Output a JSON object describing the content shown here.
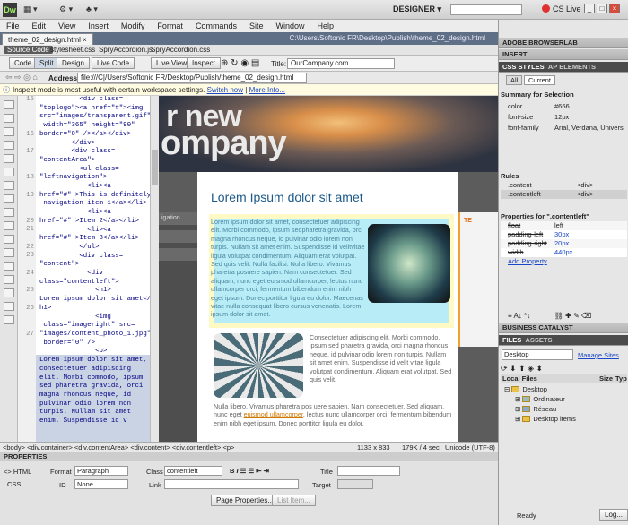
{
  "app": {
    "logo": "Dw",
    "workspace": "DESIGNER ▾",
    "cs_live": "CS Live",
    "window_controls": [
      "_",
      "□",
      "×"
    ]
  },
  "menu": [
    "File",
    "Edit",
    "View",
    "Insert",
    "Modify",
    "Format",
    "Commands",
    "Site",
    "Window",
    "Help"
  ],
  "document": {
    "tab": "theme_02_design.html ×",
    "path": "C:\\Users\\Softonic FR\\Desktop\\Publish\\theme_02_design.html",
    "related_files": [
      "Source Code",
      "stylesheet.css",
      "SpryAccordion.js",
      "SpryAccordion.css"
    ]
  },
  "toolbar": {
    "code": "Code",
    "split": "Split",
    "design": "Design",
    "live_code": "Live Code",
    "live_view": "Live View",
    "inspect": "Inspect",
    "title_label": "Title:",
    "title_value": "OurCompany.com"
  },
  "address": {
    "label": "Address:",
    "value": "file:///C|/Users/Softonic FR/Desktop/Publish/theme_02_design.html"
  },
  "infobar": {
    "text": "Inspect mode is most useful with certain workspace settings.",
    "switch": "Switch now",
    "more": "More Info..."
  },
  "code": {
    "line_numbers": [
      "15",
      "",
      "",
      "",
      "16",
      "",
      "17",
      "",
      "",
      "18",
      "",
      "19",
      "",
      "",
      "20",
      "21",
      "",
      "22",
      "23",
      "",
      "24",
      "",
      "25",
      "",
      "26",
      "",
      "",
      "27",
      "",
      "",
      "",
      "",
      "",
      "",
      "",
      ""
    ],
    "lines": [
      "          <div class=",
      "\"toplogo\"><a href=\"#\"><img",
      "src=\"images/transparent.gif\"",
      " width=\"365\" height=\"90\"",
      "border=\"0\" /></a></div>",
      "        </div>",
      "        <div class=",
      "\"contentArea\">",
      "          <ul class=",
      "\"leftnavigation\">",
      "            <li><a",
      "href=\"#\" >This is definitely",
      " navigation item 1</a></li>",
      "            <li><a",
      "href=\"#\" >Item 2</a></li>",
      "            <li><a",
      "href=\"#\" >Item 3</a></li>",
      "          </ul>",
      "          <div class=",
      "\"content\">",
      "            <div",
      "class=\"contentleft\">",
      "              <h1>",
      "Lorem ipsum dolor sit amet</",
      "h1>",
      "              <img",
      " class=\"imageright\" src=",
      "\"images/content_photo_1.jpg\"",
      " border=\"0\" />",
      "              <p>",
      "Lorem ipsum dolor sit amet,",
      "consectetuer adipiscing",
      "elit. Morbi commodo, ipsum",
      "sed pharetra gravida, orci",
      "magna rhoncus neque, id",
      "pulvinar odio lorem non",
      "turpis. Nullam sit amet",
      "enim. Suspendisse id v"
    ]
  },
  "design": {
    "logo_text_1": "r new",
    "logo_text_2": "ompany",
    "nav_items": [
      "igation",
      "",
      ""
    ],
    "heading": "Lorem Ipsum dolor sit amet",
    "para1": "Lorem ipsum dolor sit amet, consectetuer adipiscing elit. Morbi commodo, ipsum sedpharetra gravida, orci magna rhoncus neque, id pulvinar odio lorem non turpis. Nullam sit amet enim. Suspendisse id velitvitae ligula volutpat condimentum. Aliquam erat volutpat. Sed quis velit. Nulla facilisi. Nulla libero. Vivamus pharetra posuere sapien. Nam consectetuer. Sed aliquam, nunc eget euismod ullamcorper, lectus nunc ullamcorper orci, fermentum bibendum enim nibh eget ipsum. Donec porttitor ligula eu dolor. Maecenas vitae nulla consequat libero cursus venenatis. Lorem ipsum dolor sit amet.",
    "para2": "Consectetuer adipiscing elit. Morbi commodo, ipsum sed pharetra gravida, orci magna rhoncus neque, id pulvinar odio lorem non turpis. Nullam sit amet enim. Suspendisse id velit vitae ligula volutpat condimentum. Aliquam erat volutpat. Sed quis velit.",
    "para3_a": "Nulla facilisi. Nulla libero. Vivamus pharetra posuere sapien.",
    "para3_b": "Nulla libero. Vivamus pharetra pos uere sapien. Nam consectetuer. Sed aliquam, nunc eget",
    "para3_link": "euismod ullamcorper",
    "para3_c": ", lectus nunc ullamcorper orci, fermentum bibendum enim nibh eget ipsum. Donec porttitor ligula eu dolor.",
    "right_tab": "TE"
  },
  "tag_selector": {
    "tags": "<body> <div.container> <div.contentArea> <div.content> <div.contentleft> <p>",
    "size": "1133 x 833",
    "file": "179K / 4 sec",
    "encoding": "Unicode (UTF-8)"
  },
  "properties": {
    "title": "PROPERTIES",
    "html": "<> HTML",
    "css": "CSS",
    "format_label": "Format",
    "format_value": "Paragraph",
    "class_label": "Class",
    "class_value": "contentleft",
    "id_label": "ID",
    "id_value": "None",
    "link_label": "Link",
    "title_label": "Title",
    "target_label": "Target",
    "page_props": "Page Properties...",
    "list_item": "List Item..."
  },
  "panels": {
    "browserlab": "ADOBE BROWSERLAB",
    "insert": "INSERT",
    "css_styles": "CSS STYLES",
    "ap_elements": "AP ELEMENTS",
    "all": "All",
    "current": "Current",
    "summary_title": "Summary for Selection",
    "summary": [
      {
        "prop": "color",
        "val": "#666"
      },
      {
        "prop": "font-size",
        "val": "12px"
      },
      {
        "prop": "font-family",
        "val": "Arial, Verdana, Univers"
      }
    ],
    "rules_title": "Rules",
    "rules": [
      {
        "name": ".content",
        "tag": "<div>"
      },
      {
        "name": ".contentleft",
        "tag": "<div>"
      }
    ],
    "props_title": "Properties for \".contentleft\"",
    "props": [
      {
        "prop": "float",
        "val": "left"
      },
      {
        "prop": "padding-left",
        "val": "30px"
      },
      {
        "prop": "padding-right",
        "val": "20px"
      },
      {
        "prop": "width",
        "val": "440px"
      }
    ],
    "add_property": "Add Property",
    "business_catalyst": "BUSINESS CATALYST",
    "files": "FILES",
    "assets": "ASSETS",
    "site_select": "Desktop",
    "manage_sites": "Manage Sites",
    "col_local": "Local Files",
    "col_size": "Size",
    "col_type": "Typ",
    "tree": [
      "Desktop",
      "Ordinateur",
      "Réseau",
      "Desktop items"
    ],
    "status": "Ready",
    "log": "Log..."
  }
}
